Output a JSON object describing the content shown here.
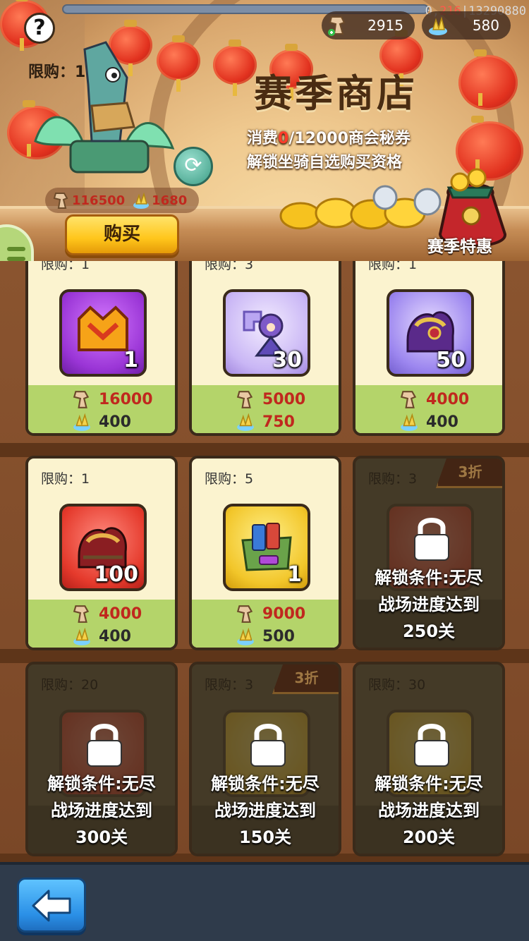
{
  "hud": {
    "coords_prefix": "0,",
    "coords_red": "216",
    "coords_suffix": "|13290880",
    "currency_a": "2915",
    "currency_b": "580"
  },
  "header": {
    "title": "赛季商店",
    "subtitle_line1_prefix": "消费",
    "subtitle_line1_red": "0",
    "subtitle_line1_suffix": "/12000商会秘券",
    "subtitle_line2": "解锁坐骑自选购买资格",
    "featured_limit": "限购：1",
    "featured_price_a": "116500",
    "featured_price_b": "1680",
    "buy_label": "购买",
    "season_deal_label": "赛季特惠"
  },
  "colors": {
    "price_red": "#c0281e",
    "card_bg": "#fbf3cf",
    "price_band": "#b4d46a",
    "locked_bg": "#5c5138"
  },
  "shop": {
    "row1": [
      {
        "limit": "限购：1",
        "qty": "1",
        "price_a": "16000",
        "price_b": "400",
        "icon": "crown-chest-icon"
      },
      {
        "limit": "限购：3",
        "qty": "30",
        "price_a": "5000",
        "price_b": "750",
        "icon": "hero-puzzle-icon"
      },
      {
        "limit": "限购：1",
        "qty": "50",
        "price_a": "4000",
        "price_b": "400",
        "icon": "saddle-icon"
      }
    ],
    "row2": [
      {
        "limit": "限购：1",
        "qty": "100",
        "price_a": "4000",
        "price_b": "400",
        "icon": "red-saddle-icon"
      },
      {
        "limit": "限购：5",
        "qty": "1",
        "price_a": "9000",
        "price_b": "500",
        "icon": "card-pack-icon"
      },
      {
        "limit": "限购：3",
        "discount": "3折",
        "lock_line1": "解锁条件:无尽",
        "lock_line2": "战场进度达到",
        "lock_line3": "250关"
      }
    ],
    "row3": [
      {
        "limit": "限购：20",
        "lock_line1": "解锁条件:无尽",
        "lock_line2": "战场进度达到",
        "lock_line3": "300关"
      },
      {
        "limit": "限购：3",
        "discount": "3折",
        "lock_line1": "解锁条件:无尽",
        "lock_line2": "战场进度达到",
        "lock_line3": "150关"
      },
      {
        "limit": "限购：30",
        "lock_line1": "解锁条件:无尽",
        "lock_line2": "战场进度达到",
        "lock_line3": "200关"
      }
    ]
  }
}
